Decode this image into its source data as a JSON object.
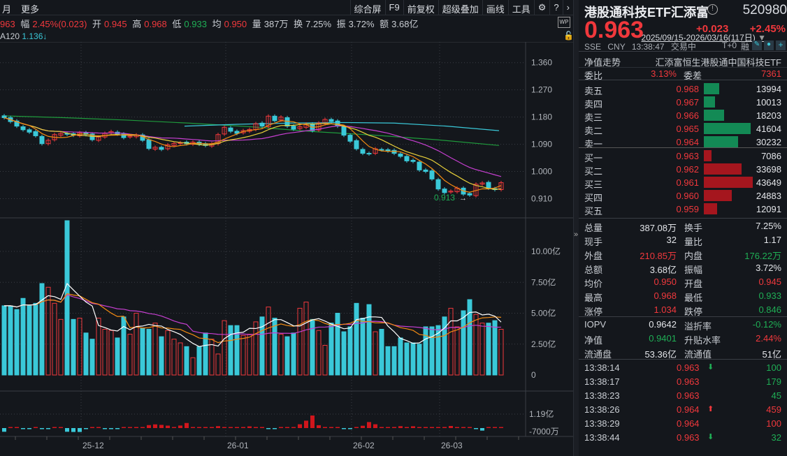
{
  "toolbar": {
    "left": [
      "月",
      "更多"
    ],
    "right": [
      "综合屏",
      "F9",
      "前复权",
      "超级叠加",
      "画线",
      "工具"
    ]
  },
  "info": {
    "price_tail": "963",
    "amp_label": "幅",
    "amp": "2.45%(0.023)",
    "open_label": "开",
    "open": "0.945",
    "high_label": "高",
    "high": "0.968",
    "low_label": "低",
    "low": "0.933",
    "avg_label": "均",
    "avg": "0.950",
    "vol_label": "量",
    "vol": "387万",
    "turn_label": "换",
    "turn": "7.25%",
    "swing_label": "振",
    "swing": "3.72%",
    "amount_label": "额",
    "amount": "3.68亿"
  },
  "ma_readout": {
    "label": "A120",
    "value": "1.136↓"
  },
  "date_range": "2025/09/15-2026/03/16(117日)",
  "wp_label": "WP",
  "colors": {
    "up": "#f0383c",
    "down": "#3ac8d8",
    "green": "#1fae55",
    "bg": "#14171c"
  },
  "chart_data": {
    "type": "candlestick",
    "price_axis": {
      "ticks": [
        "1.360",
        "1.270",
        "1.180",
        "1.090",
        "1.000",
        "0.910"
      ],
      "range": [
        0.885,
        1.39
      ]
    },
    "low_marker": "0.913",
    "close": [
      1.178,
      1.165,
      1.15,
      1.138,
      1.13,
      1.118,
      1.092,
      1.103,
      1.122,
      1.126,
      1.123,
      1.12,
      1.128,
      1.122,
      1.105,
      1.114,
      1.126,
      1.132,
      1.124,
      1.112,
      1.117,
      1.121,
      1.103,
      1.076,
      1.08,
      1.073,
      1.088,
      1.093,
      1.095,
      1.092,
      1.097,
      1.09,
      1.086,
      1.092,
      1.122,
      1.146,
      1.133,
      1.126,
      1.135,
      1.139,
      1.158,
      1.15,
      1.183,
      1.168,
      1.18,
      1.15,
      1.14,
      1.148,
      1.157,
      1.135,
      1.16,
      1.172,
      1.165,
      1.15,
      1.12,
      1.1,
      1.075,
      1.06,
      1.058,
      1.075,
      1.072,
      1.068,
      1.06,
      1.05,
      1.035,
      1.033,
      1.005,
      1.0,
      0.975,
      0.942,
      0.93,
      0.935,
      0.945,
      0.925,
      0.922,
      0.958,
      0.962,
      0.945,
      0.94,
      0.963
    ],
    "ma60": [
      1.184,
      1.178,
      1.17,
      1.16,
      1.148,
      1.132,
      1.12,
      1.105,
      1.086
    ],
    "ma120_start_index": 29,
    "ma120": [
      1.15,
      1.156,
      1.16,
      1.162,
      1.16,
      1.15,
      1.135
    ],
    "volume_axis": {
      "ticks": [
        "10.00亿",
        "7.50亿",
        "5.00亿",
        "2.50亿",
        "0"
      ],
      "max": 12.5
    },
    "volume": [
      5.6,
      5.6,
      5.3,
      6.2,
      5.6,
      5.8,
      7.4,
      7.1,
      5.8,
      4.5,
      12.5,
      4.5,
      4.6,
      3.4,
      2.9,
      4.6,
      3.7,
      3.6,
      3.0,
      4.7,
      3.3,
      5.0,
      3.8,
      3.7,
      4.2,
      3.1,
      3.6,
      2.9,
      2.6,
      2.3,
      1.4,
      2.3,
      3.4,
      2.9,
      1.7,
      4.4,
      4.0,
      4.0,
      3.2,
      3.3,
      4.3,
      4.7,
      5.5,
      4.6,
      3.3,
      3.1,
      3.4,
      5.4,
      5.9,
      4.5,
      3.6,
      2.4,
      4.2,
      5.0,
      3.5,
      3.9,
      5.8,
      4.6,
      5.7,
      3.5,
      3.7,
      2.3,
      2.3,
      3.0,
      2.6,
      2.6,
      2.5,
      3.9,
      3.9,
      4.0,
      4.7,
      5.4,
      3.9,
      5.2,
      6.1,
      4.9,
      4.2,
      4.2,
      4.4,
      3.7
    ],
    "flow_axis": {
      "ticks": [
        "1.19亿",
        "-7000万"
      ]
    },
    "flow": [
      -3500,
      600,
      600,
      -500,
      -800,
      600,
      -500,
      -300,
      0,
      0,
      -3500,
      -3700,
      -3700,
      -200,
      0,
      0,
      -300,
      -800,
      -300,
      0,
      500,
      0,
      300,
      2800,
      3500,
      3000,
      2300,
      600,
      2400,
      4800,
      0,
      0,
      0,
      900,
      1800,
      0,
      500,
      0,
      0,
      1600,
      1000,
      0,
      -400,
      -400,
      0,
      500,
      0,
      3600,
      7000,
      11900,
      2700,
      0,
      600,
      0,
      -400,
      -400,
      600,
      2200,
      5700,
      3600,
      800,
      600,
      1000,
      1800,
      0,
      1700,
      0,
      800,
      400,
      500,
      0,
      2000,
      700,
      0,
      800,
      -1000,
      -2400,
      0,
      0,
      500
    ],
    "date_ticks": [
      {
        "index": 12,
        "label": "25-12"
      },
      {
        "index": 35,
        "label": "26-01"
      },
      {
        "index": 55,
        "label": "26-02"
      },
      {
        "index": 69,
        "label": "26-03"
      }
    ]
  },
  "quote": {
    "name": "港股通科技ETF汇添富",
    "code": "520980",
    "price": "0.963",
    "change": "+0.023",
    "change_pct": "+2.45%",
    "exchange": "SSE",
    "currency": "CNY",
    "time": "13:38:47",
    "status": "交易中",
    "t0": "T+0",
    "margin": "融"
  },
  "nav_trend": {
    "label": "净值走势",
    "fund_name": "汇添富恒生港股通中国科技ETF"
  },
  "weibi": {
    "label": "委比",
    "value": "3.13%",
    "diff_label": "委差",
    "diff": "7361"
  },
  "asks": [
    {
      "label": "卖五",
      "price": "0.968",
      "vol": "13994",
      "qty": 13994
    },
    {
      "label": "卖四",
      "price": "0.967",
      "vol": "10013",
      "qty": 10013
    },
    {
      "label": "卖三",
      "price": "0.966",
      "vol": "18203",
      "qty": 18203
    },
    {
      "label": "卖二",
      "price": "0.965",
      "vol": "41604",
      "qty": 41604
    },
    {
      "label": "卖一",
      "price": "0.964",
      "vol": "30232",
      "qty": 30232
    }
  ],
  "bids": [
    {
      "label": "买一",
      "price": "0.963",
      "vol": "7086",
      "qty": 7086
    },
    {
      "label": "买二",
      "price": "0.962",
      "vol": "33698",
      "qty": 33698
    },
    {
      "label": "买三",
      "price": "0.961",
      "vol": "43649",
      "qty": 43649
    },
    {
      "label": "买四",
      "price": "0.960",
      "vol": "24883",
      "qty": 24883
    },
    {
      "label": "买五",
      "price": "0.959",
      "vol": "12091",
      "qty": 12091
    }
  ],
  "stats": [
    [
      {
        "l": "总量",
        "v": "387.08万",
        "c": "white"
      },
      {
        "l": "换手",
        "v": "7.25%",
        "c": "white"
      }
    ],
    [
      {
        "l": "现手",
        "v": "32",
        "c": "white"
      },
      {
        "l": "量比",
        "v": "1.17",
        "c": "white"
      }
    ],
    [
      {
        "l": "外盘",
        "v": "210.85万",
        "c": "red"
      },
      {
        "l": "内盘",
        "v": "176.22万",
        "c": "green"
      }
    ],
    [
      {
        "l": "总额",
        "v": "3.68亿",
        "c": "white"
      },
      {
        "l": "振幅",
        "v": "3.72%",
        "c": "white"
      }
    ],
    [
      {
        "l": "均价",
        "v": "0.950",
        "c": "red"
      },
      {
        "l": "开盘",
        "v": "0.945",
        "c": "red"
      }
    ],
    [
      {
        "l": "最高",
        "v": "0.968",
        "c": "red"
      },
      {
        "l": "最低",
        "v": "0.933",
        "c": "green"
      }
    ],
    [
      {
        "l": "涨停",
        "v": "1.034",
        "c": "red"
      },
      {
        "l": "跌停",
        "v": "0.846",
        "c": "green"
      }
    ]
  ],
  "etf_stats": [
    [
      {
        "l": "IOPV",
        "v": "0.9642",
        "c": "white"
      },
      {
        "l": "溢折率",
        "v": "-0.12%",
        "c": "green"
      }
    ],
    [
      {
        "l": "净值",
        "v": "0.9401",
        "c": "green"
      },
      {
        "l": "升贴水率",
        "v": "2.44%",
        "c": "red"
      }
    ],
    [
      {
        "l": "流通盘",
        "v": "53.36亿",
        "c": "white"
      },
      {
        "l": "流通值",
        "v": "51亿",
        "c": "white"
      }
    ]
  ],
  "trades": [
    {
      "time": "13:38:14",
      "price": "0.963",
      "dir": "down",
      "vol": "100",
      "c": "green"
    },
    {
      "time": "13:38:17",
      "price": "0.963",
      "dir": "",
      "vol": "179",
      "c": "green"
    },
    {
      "time": "13:38:23",
      "price": "0.963",
      "dir": "",
      "vol": "45",
      "c": "green"
    },
    {
      "time": "13:38:26",
      "price": "0.964",
      "dir": "up",
      "vol": "459",
      "c": "red"
    },
    {
      "time": "13:38:29",
      "price": "0.964",
      "dir": "",
      "vol": "100",
      "c": "red"
    },
    {
      "time": "13:38:44",
      "price": "0.963",
      "dir": "down",
      "vol": "32",
      "c": "green"
    }
  ]
}
